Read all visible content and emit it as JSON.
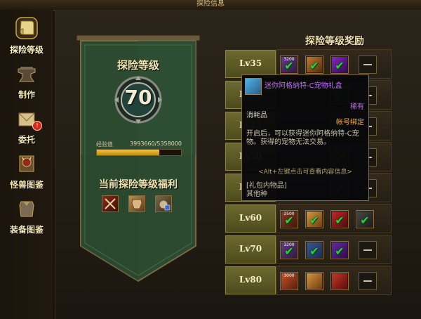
{
  "window_title": "探险信息",
  "nav": {
    "items": [
      {
        "label": "探险等级",
        "icon": "scroll-icon",
        "active": true
      },
      {
        "label": "制作",
        "icon": "anvil-icon"
      },
      {
        "label": "委托",
        "icon": "envelope-icon",
        "badge": "!"
      },
      {
        "label": "怪兽图鉴",
        "icon": "monster-book-icon"
      },
      {
        "label": "装备图鉴",
        "icon": "equipment-book-icon"
      }
    ]
  },
  "rank": {
    "title": "探险等级",
    "level": "70",
    "exp_label": "经验值",
    "exp_value": "3993660/5358000",
    "exp_fraction": 0.745
  },
  "benefits": {
    "title": "当前探险等级福利",
    "icons": [
      "crossed-swords-icon",
      "armor-icon",
      "pet-icon"
    ]
  },
  "rewards": {
    "title": "探险等级奖励",
    "rows": [
      {
        "level": "Lv35",
        "slots": [
          "claimed",
          "claimed",
          "claimed",
          "empty"
        ],
        "numbers": [
          "3200",
          "",
          "",
          ""
        ]
      },
      {
        "level": "Lv40",
        "slots": [
          "claimed",
          "claimed",
          "claimed",
          "empty"
        ],
        "numbers": [
          "",
          "",
          "",
          ""
        ]
      },
      {
        "level": "Lv45",
        "slots": [
          "claimed",
          "claimed",
          "claimed",
          "empty"
        ],
        "numbers": [
          "",
          "",
          "",
          ""
        ]
      },
      {
        "level": "Lv50",
        "slots": [
          "claimed",
          "claimed",
          "claimed",
          "empty"
        ],
        "numbers": [
          "",
          "",
          "",
          ""
        ]
      },
      {
        "level": "Lv55",
        "slots": [
          "claimed",
          "claimed",
          "claimed",
          "empty"
        ],
        "numbers": [
          "",
          "",
          "",
          ""
        ]
      },
      {
        "level": "Lv60",
        "slots": [
          "claimed",
          "claimed",
          "claimed",
          "claimed"
        ],
        "numbers": [
          "2500",
          "",
          "",
          ""
        ]
      },
      {
        "level": "Lv70",
        "slots": [
          "claimed",
          "claimed",
          "claimed",
          "empty"
        ],
        "numbers": [
          "3200",
          "",
          "",
          ""
        ]
      },
      {
        "level": "Lv80",
        "slots": [
          "item",
          "item",
          "item",
          "empty"
        ],
        "numbers": [
          "3000",
          "",
          "",
          ""
        ]
      }
    ]
  },
  "tooltip": {
    "name": "迷你阿格纳特-C宠物礼盒",
    "rarity": "稀有",
    "type": "消耗品",
    "bind": "帐号绑定",
    "description": "开启后，可以获得迷你阿格纳特-C宠物。获得的宠物无法交易。",
    "hint": "<Alt+左键点击可查看内容信息>",
    "contents_header": "[礼包内物品]",
    "contents_body": "其他种"
  },
  "colors": {
    "check": "#22d638",
    "rarity": "#bf66ff",
    "bind": "#f0b040",
    "banner_green": "#2f4f33",
    "level_cell": "#6c6a2e"
  }
}
